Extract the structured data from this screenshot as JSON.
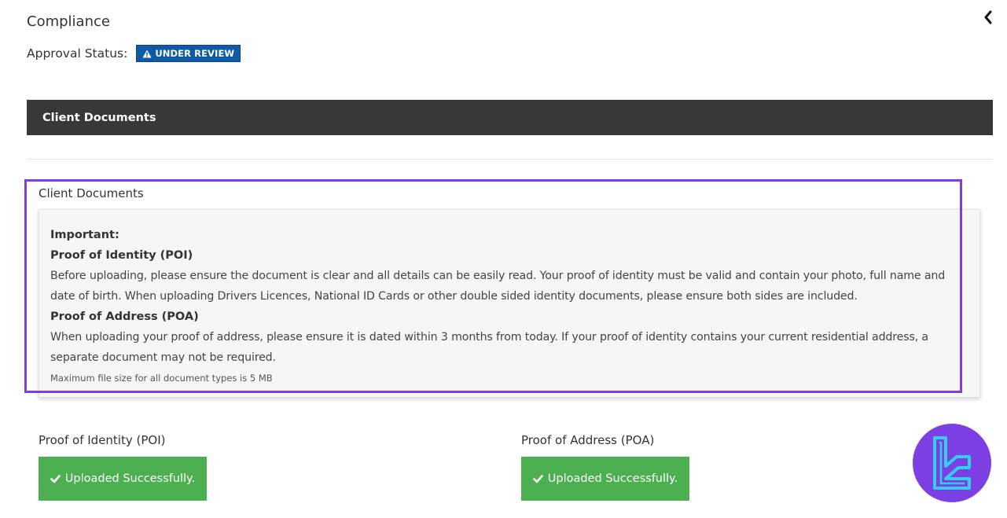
{
  "header": {
    "title": "Compliance",
    "approval_label": "Approval Status:",
    "status_badge": "UNDER REVIEW"
  },
  "section": {
    "header_title": "Client Documents"
  },
  "documents": {
    "title": "Client Documents",
    "important_label": "Important:",
    "poi_heading": "Proof of Identity (POI)",
    "poi_text": "Before uploading, please ensure the document is clear and all details can be easily read. Your proof of identity must be valid and contain your photo, full name and date of birth. When uploading Drivers Licences, National ID Cards or other double sided identity documents, please ensure both sides are included.",
    "poa_heading": "Proof of Address (POA)",
    "poa_text": "When uploading your proof of address, please ensure it is dated within 3 months from today. If your proof of identity contains your current residential address, a separate document may not be required.",
    "max_size_note": "Maximum file size for all document types is 5 MB"
  },
  "uploads": {
    "poi_label": "Proof of Identity (POI)",
    "poi_status": "Uploaded Successfully.",
    "poa_label": "Proof of Address (POA)",
    "poa_status": "Uploaded Successfully."
  },
  "icons": {
    "collapse": "chevron-left-icon",
    "badge": "warning-icon",
    "success": "check-icon",
    "logo": "brand-logo"
  },
  "colors": {
    "badge_bg": "#0f5aa6",
    "header_bg": "#383838",
    "success_bg": "#4caf50",
    "highlight": "#7b3fe4",
    "logo_bg": "#7b3fe4",
    "logo_fg": "#2fd0f0"
  }
}
